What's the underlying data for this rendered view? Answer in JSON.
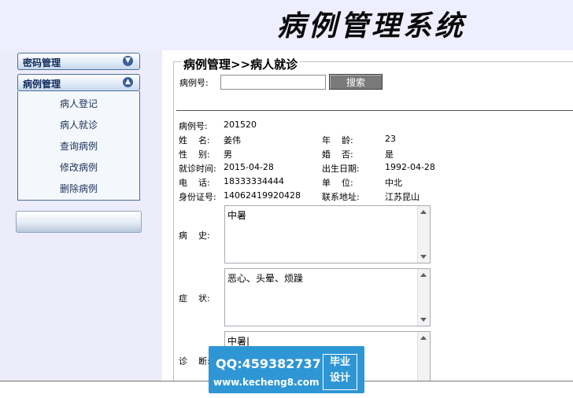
{
  "header": {
    "title": "病例管理系统"
  },
  "sidebar": {
    "groups": [
      {
        "label": "密码管理"
      },
      {
        "label": "病例管理"
      }
    ],
    "items": [
      {
        "label": "病人登记"
      },
      {
        "label": "病人就诊"
      },
      {
        "label": "查询病例"
      },
      {
        "label": "修改病例"
      },
      {
        "label": "删除病例"
      }
    ]
  },
  "panel": {
    "title": "病例管理>>病人就诊",
    "search_label": "病例号:",
    "search_value": "",
    "search_button": "搜索"
  },
  "record": {
    "case_no_label": "病例号:",
    "case_no": "201520",
    "name_label": "姓    名:",
    "name": "姜伟",
    "age_label": "年    龄:",
    "age": "23",
    "gender_label": "性    别:",
    "gender": "男",
    "married_label": "婚    否:",
    "married": "是",
    "visit_time_label": "就诊时间:",
    "visit_time": "2015-04-28",
    "birth_label": "出生日期:",
    "birth": "1992-04-28",
    "phone_label": "电    话:",
    "phone": "18333334444",
    "unit_label": "单    位:",
    "unit": "中北",
    "id_label": "身份证号:",
    "id_no": "14062419920428",
    "address_label": "联系地址:",
    "address": "江苏昆山",
    "history_label": "病    史:",
    "history": "中暑",
    "symptom_label": "症    状:",
    "symptom": "恶心、头晕、烦躁",
    "diagnosis_label": "诊    断:",
    "diagnosis": "中暑|"
  },
  "watermark": {
    "qq": "QQ:459382737",
    "url": "www.kecheng8.com",
    "tag1": "毕业",
    "tag2": "设计"
  }
}
